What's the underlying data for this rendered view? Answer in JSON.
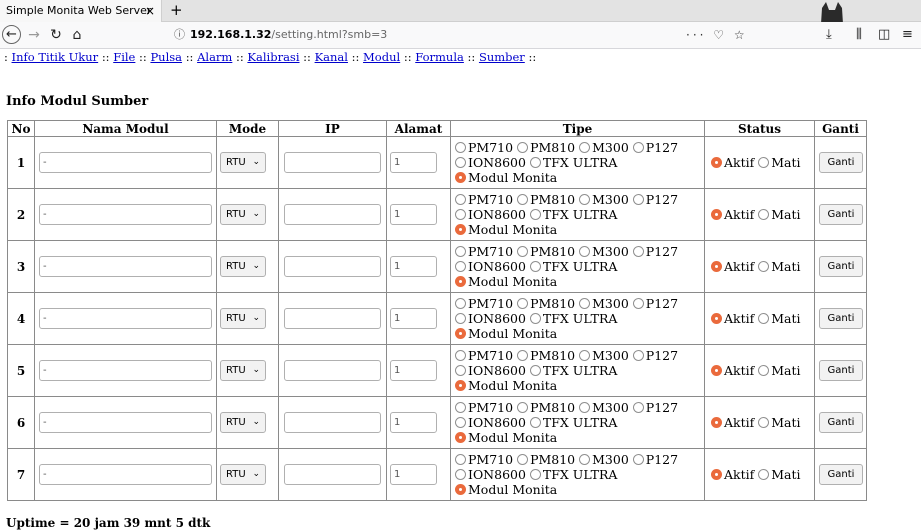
{
  "browser": {
    "tab_title": "Simple Monita Web Server",
    "tab_close": "×",
    "new_tab": "+",
    "url_info_icon": "ⓘ",
    "url_host": "192.168.1.32",
    "url_path": "/setting.html?smb=3",
    "url_actions": "··· ♡ ☆",
    "icons": [
      "back-arrow-icon",
      "forward-arrow-icon",
      "reload-icon",
      "home-icon",
      "download-icon",
      "library-icon",
      "sidebar-icon",
      "menu-icon"
    ]
  },
  "menu": {
    "prefix": ":",
    "sep": "::",
    "items": [
      "Info Titik Ukur",
      "File",
      "Pulsa",
      "Alarm",
      "Kalibrasi",
      "Kanal",
      "Modul",
      "Formula",
      "Sumber"
    ]
  },
  "title": "Info Modul Sumber",
  "table": {
    "headers": [
      "No",
      "Nama Modul",
      "Mode",
      "IP",
      "Alamat",
      "Tipe",
      "Status",
      "Ganti"
    ],
    "tipe_options": [
      "PM710",
      "PM810",
      "M300",
      "P127",
      "ION8600",
      "TFX ULTRA",
      "Modul Monita"
    ],
    "status_options": [
      "Aktif",
      "Mati"
    ],
    "rows": [
      {
        "no": "1",
        "nama": "-",
        "mode": "RTU",
        "ip": "",
        "alamat": "1",
        "tipe": "Modul Monita",
        "status": "Aktif",
        "ganti": "Ganti"
      },
      {
        "no": "2",
        "nama": "-",
        "mode": "RTU",
        "ip": "",
        "alamat": "1",
        "tipe": "Modul Monita",
        "status": "Aktif",
        "ganti": "Ganti"
      },
      {
        "no": "3",
        "nama": "-",
        "mode": "RTU",
        "ip": "",
        "alamat": "1",
        "tipe": "Modul Monita",
        "status": "Aktif",
        "ganti": "Ganti"
      },
      {
        "no": "4",
        "nama": "-",
        "mode": "RTU",
        "ip": "",
        "alamat": "1",
        "tipe": "Modul Monita",
        "status": "Aktif",
        "ganti": "Ganti"
      },
      {
        "no": "5",
        "nama": "-",
        "mode": "RTU",
        "ip": "",
        "alamat": "1",
        "tipe": "Modul Monita",
        "status": "Aktif",
        "ganti": "Ganti"
      },
      {
        "no": "6",
        "nama": "-",
        "mode": "RTU",
        "ip": "",
        "alamat": "1",
        "tipe": "Modul Monita",
        "status": "Aktif",
        "ganti": "Ganti"
      },
      {
        "no": "7",
        "nama": "-",
        "mode": "RTU",
        "ip": "",
        "alamat": "1",
        "tipe": "Modul Monita",
        "status": "Aktif",
        "ganti": "Ganti"
      }
    ]
  },
  "uptime": "Uptime = 20 jam 39 mnt 5 dtk",
  "colors": {
    "radio_selected": "#ea6a3c",
    "link": "#0000cc"
  }
}
